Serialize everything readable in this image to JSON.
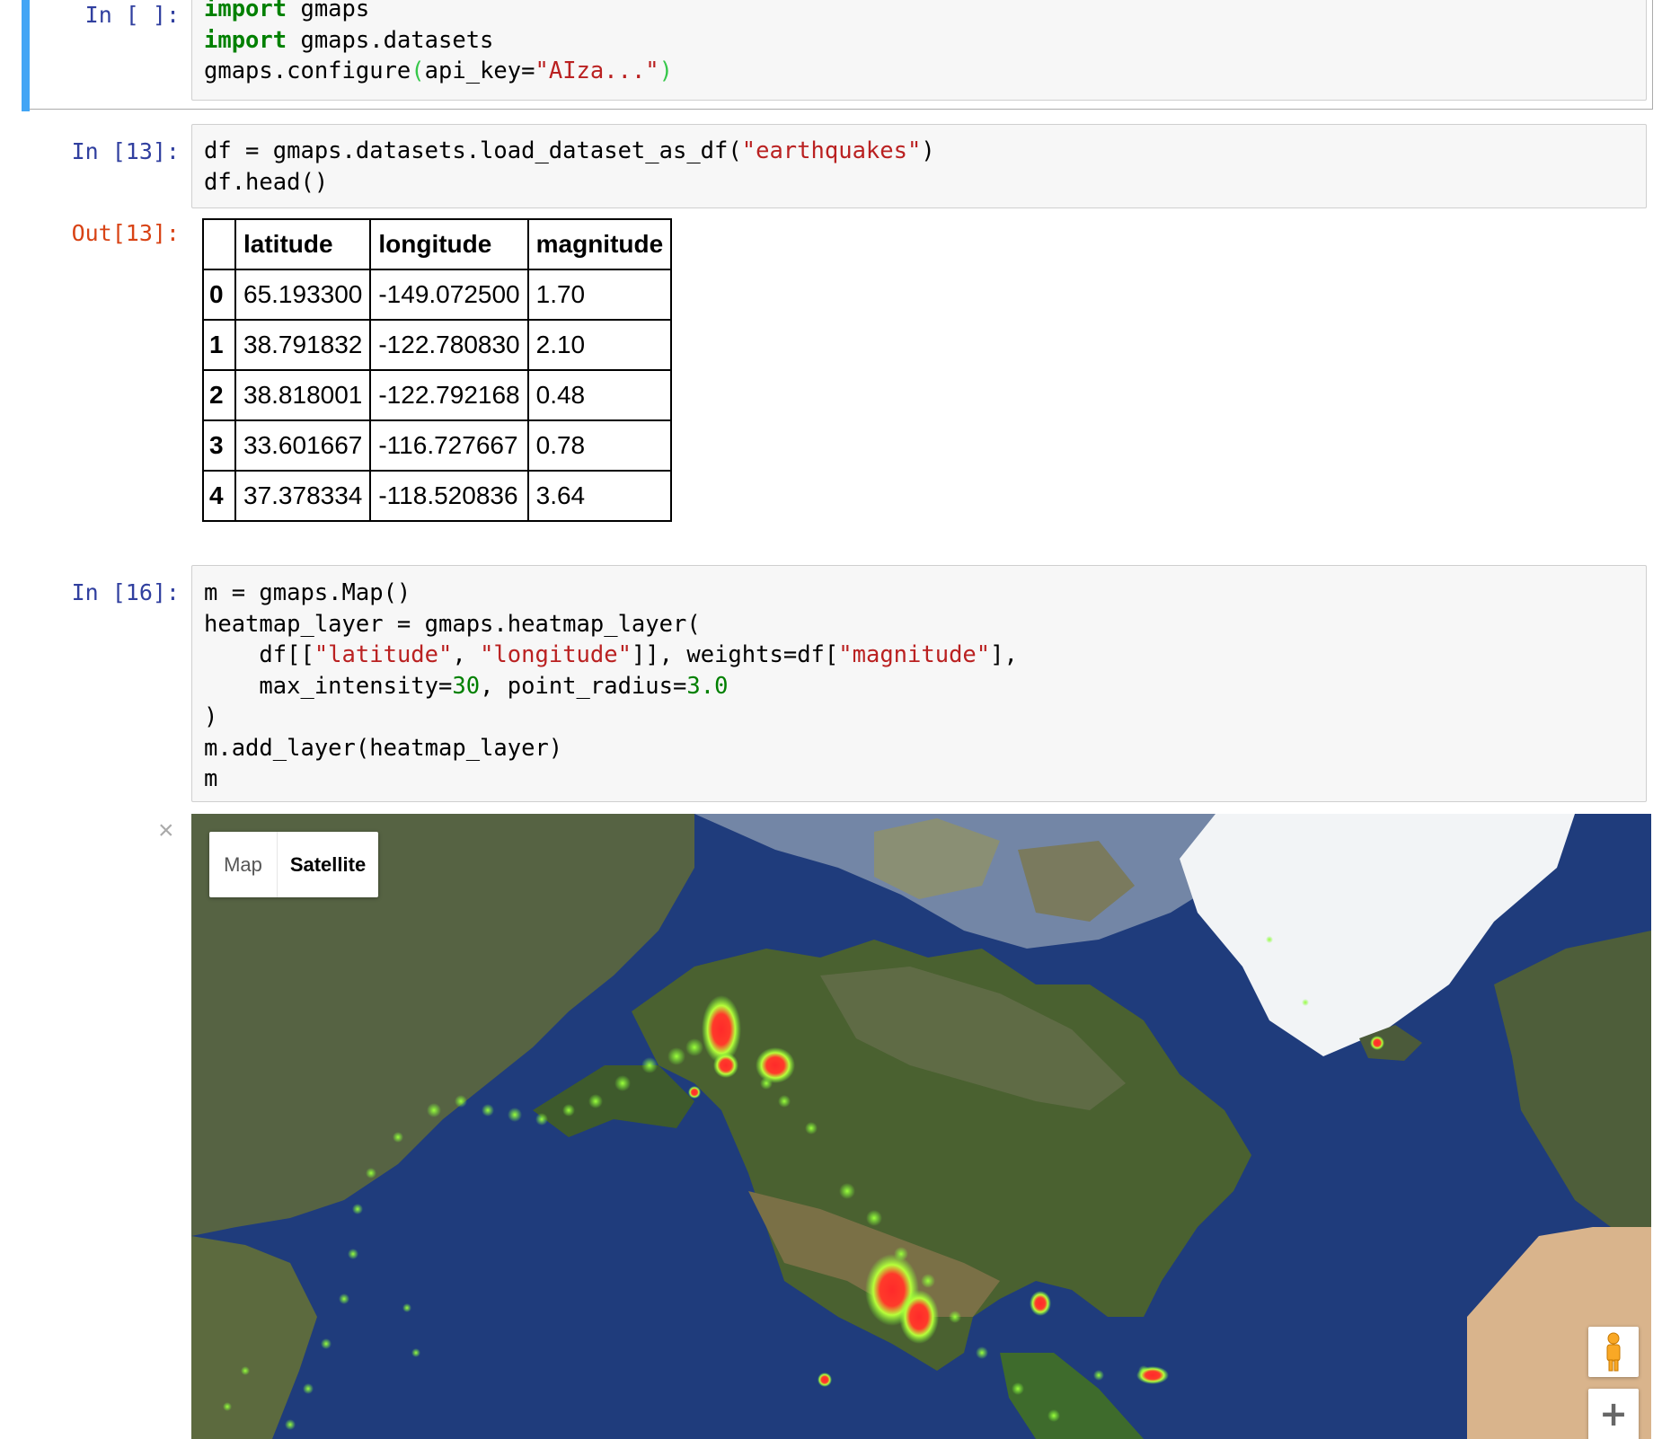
{
  "cells": [
    {
      "prompt": "In [ ]:",
      "lines": [
        [
          {
            "t": "import",
            "c": "kw"
          },
          {
            "t": " gmaps"
          }
        ],
        [
          {
            "t": "import",
            "c": "kw"
          },
          {
            "t": " gmaps.datasets"
          }
        ],
        [
          {
            "t": "gmaps.configure"
          },
          {
            "t": "(",
            "c": "paren-g"
          },
          {
            "t": "api_key="
          },
          {
            "t": "\"AIza...\"",
            "c": "str"
          },
          {
            "t": ")",
            "c": "paren-g"
          }
        ]
      ]
    },
    {
      "prompt": "In [13]:",
      "lines": [
        [
          {
            "t": "df = gmaps.datasets.load_dataset_as_df("
          },
          {
            "t": "\"earthquakes\"",
            "c": "str"
          },
          {
            "t": ")"
          }
        ],
        [
          {
            "t": "df.head()"
          }
        ]
      ]
    },
    {
      "prompt": "In [16]:",
      "lines": [
        [
          {
            "t": "m = gmaps.Map()"
          }
        ],
        [
          {
            "t": "heatmap_layer = gmaps.heatmap_layer("
          }
        ],
        [
          {
            "t": "    df[["
          },
          {
            "t": "\"latitude\"",
            "c": "str"
          },
          {
            "t": ", "
          },
          {
            "t": "\"longitude\"",
            "c": "str"
          },
          {
            "t": "]], weights=df["
          },
          {
            "t": "\"magnitude\"",
            "c": "str"
          },
          {
            "t": "],"
          }
        ],
        [
          {
            "t": "    max_intensity="
          },
          {
            "t": "30",
            "c": "num"
          },
          {
            "t": ", point_radius="
          },
          {
            "t": "3.0",
            "c": "num"
          }
        ],
        [
          {
            "t": ")"
          }
        ],
        [
          {
            "t": "m.add_layer(heatmap_layer)"
          }
        ],
        [
          {
            "t": "m"
          }
        ]
      ]
    }
  ],
  "output": {
    "prompt": "Out[13]:",
    "table": {
      "columns": [
        "",
        "latitude",
        "longitude",
        "magnitude"
      ],
      "rows": [
        [
          "0",
          "65.193300",
          "-149.072500",
          "1.70"
        ],
        [
          "1",
          "38.791832",
          "-122.780830",
          "2.10"
        ],
        [
          "2",
          "38.818001",
          "-122.792168",
          "0.48"
        ],
        [
          "3",
          "33.601667",
          "-116.727667",
          "0.78"
        ],
        [
          "4",
          "37.378334",
          "-118.520836",
          "3.64"
        ]
      ]
    }
  },
  "map": {
    "close_glyph": "×",
    "map_type_options": [
      "Map",
      "Satellite"
    ],
    "selected_map_type": "Satellite",
    "zoom_in_glyph": "+",
    "colors": {
      "ocean": "#1e3b7a",
      "land": "#3f5a2a",
      "ice": "#f2f4f6",
      "heat_low": "#7cff3a",
      "heat_high": "#ff2a2a"
    }
  }
}
